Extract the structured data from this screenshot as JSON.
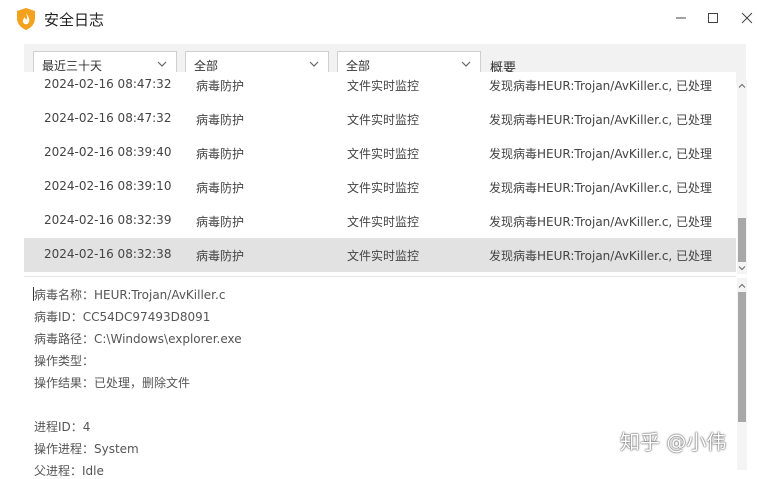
{
  "window": {
    "title": "安全日志",
    "minimize_glyph": "—",
    "maximize_glyph": "☐",
    "close_glyph": "✕"
  },
  "filters": {
    "time_range": "最近三十天",
    "type": "全部",
    "source": "全部",
    "summary_header": "概要"
  },
  "log_rows": [
    {
      "time": "2024-02-16 08:47:32",
      "type": "病毒防护",
      "source": "文件实时监控",
      "summary": "发现病毒HEUR:Trojan/AvKiller.c, 已处理"
    },
    {
      "time": "2024-02-16 08:47:32",
      "type": "病毒防护",
      "source": "文件实时监控",
      "summary": "发现病毒HEUR:Trojan/AvKiller.c, 已处理"
    },
    {
      "time": "2024-02-16 08:39:40",
      "type": "病毒防护",
      "source": "文件实时监控",
      "summary": "发现病毒HEUR:Trojan/AvKiller.c, 已处理"
    },
    {
      "time": "2024-02-16 08:39:10",
      "type": "病毒防护",
      "source": "文件实时监控",
      "summary": "发现病毒HEUR:Trojan/AvKiller.c, 已处理"
    },
    {
      "time": "2024-02-16 08:32:39",
      "type": "病毒防护",
      "source": "文件实时监控",
      "summary": "发现病毒HEUR:Trojan/AvKiller.c, 已处理"
    },
    {
      "time": "2024-02-16 08:32:38",
      "type": "病毒防护",
      "source": "文件实时监控",
      "summary": "发现病毒HEUR:Trojan/AvKiller.c, 已处理"
    }
  ],
  "detail_lines": [
    "病毒名称：HEUR:Trojan/AvKiller.c",
    "病毒ID：CC54DC97493D8091",
    "病毒路径：C:\\Windows\\explorer.exe",
    "操作类型：",
    "操作结果：已处理，删除文件",
    "",
    "进程ID：4",
    "操作进程：System",
    "父进程：Idle"
  ],
  "watermark": "知乎 @小伟",
  "icons": {
    "app": "shield-flame-icon",
    "dropdown": "chevron-down-icon",
    "scroll_up": "chevron-up-icon",
    "scroll_down": "chevron-down-icon"
  },
  "colors": {
    "selected_row": "#e2e2e2",
    "filter_bar": "#f2f2f2",
    "scroll_thumb": "#a8a8a8",
    "app_icon_orange": "#f4a11d"
  }
}
